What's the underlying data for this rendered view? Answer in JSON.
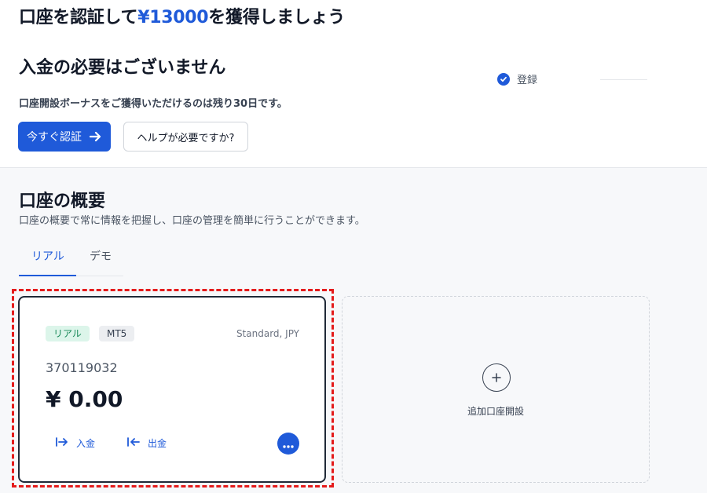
{
  "promo": {
    "headline_pre": "口座を認証して",
    "headline_amount": "¥13000",
    "headline_post": "を獲得しましょう",
    "headline2": "入金の必要はございません",
    "bonus_note": "口座開設ボーナスをご獲得いただけるのは残り30日です。",
    "verify_button": "今すぐ認証",
    "help_button": "ヘルプが必要ですか?"
  },
  "steps": [
    {
      "label": "登録",
      "done": true
    }
  ],
  "overview": {
    "title": "口座の概要",
    "subtitle": "口座の概要で常に情報を把握し、口座の管理を簡単に行うことができます。",
    "tabs": [
      {
        "label": "リアル",
        "active": true
      },
      {
        "label": "デモ",
        "active": false
      }
    ]
  },
  "account_card": {
    "badge_type": "リアル",
    "badge_platform": "MT5",
    "account_type": "Standard, JPY",
    "account_number": "370119032",
    "balance": "¥ 0.00",
    "deposit_label": "入金",
    "withdraw_label": "出金"
  },
  "add_account": {
    "label": "追加口座開設"
  },
  "colors": {
    "accent": "#1f5ad9",
    "highlight": "#e41b1b",
    "badge_real_bg": "#dcf5ea",
    "badge_real_text": "#1a8a5a"
  }
}
